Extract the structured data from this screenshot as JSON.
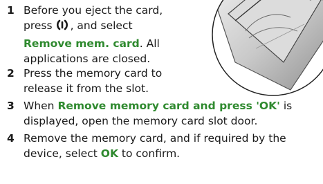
{
  "steps": [
    {
      "number": "1",
      "line1": "Before you eject the card,",
      "line2_pre": "press",
      "line2_post": ", and select",
      "line3_highlight": "Remove mem. card",
      "line3_post": ". All",
      "line4": "applications are closed."
    },
    {
      "number": "2",
      "line1": "Press the memory card to",
      "line2": "release it from the slot."
    },
    {
      "number": "3",
      "line1_pre": "When",
      "line1_highlight": "Remove memory card and press 'OK'",
      "line1_post": "is",
      "line2": "displayed, open the memory card slot door."
    },
    {
      "number": "4",
      "line1": "Remove the memory card, and if required by the",
      "line2_pre": "device, select",
      "line2_highlight": "OK",
      "line2_post": "to confirm."
    }
  ],
  "icons": {
    "power_key": "power-icon",
    "illustration": "device-card-slot-illustration"
  },
  "colors": {
    "highlight": "#2f8a2f",
    "text": "#1a1a1a"
  }
}
